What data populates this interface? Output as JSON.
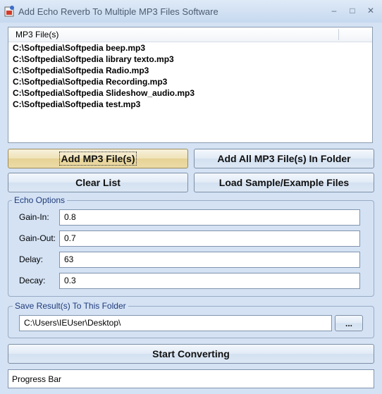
{
  "window": {
    "title": "Add Echo Reverb To Multiple MP3 Files Software",
    "controls": {
      "minimize": "–",
      "maximize": "□",
      "close": "✕"
    }
  },
  "file_list": {
    "header": "MP3 File(s)",
    "items": [
      "C:\\Softpedia\\Softpedia beep.mp3",
      "C:\\Softpedia\\Softpedia library texto.mp3",
      "C:\\Softpedia\\Softpedia Radio.mp3",
      "C:\\Softpedia\\Softpedia Recording.mp3",
      "C:\\Softpedia\\Softpedia Slideshow_audio.mp3",
      "C:\\Softpedia\\Softpedia test.mp3"
    ]
  },
  "buttons": {
    "add_files": "Add MP3 File(s)",
    "add_folder": "Add All MP3 File(s) In Folder",
    "clear_list": "Clear List",
    "load_sample": "Load Sample/Example Files",
    "browse": "...",
    "start": "Start Converting"
  },
  "echo_options": {
    "legend": "Echo Options",
    "gain_in": {
      "label": "Gain-In:",
      "value": "0.8"
    },
    "gain_out": {
      "label": "Gain-Out:",
      "value": "0.7"
    },
    "delay": {
      "label": "Delay:",
      "value": "63"
    },
    "decay": {
      "label": "Decay:",
      "value": "0.3"
    }
  },
  "save_folder": {
    "legend": "Save Result(s) To This Folder",
    "path": "C:\\Users\\IEUser\\Desktop\\"
  },
  "progress": {
    "label": "Progress Bar",
    "value": 0
  }
}
